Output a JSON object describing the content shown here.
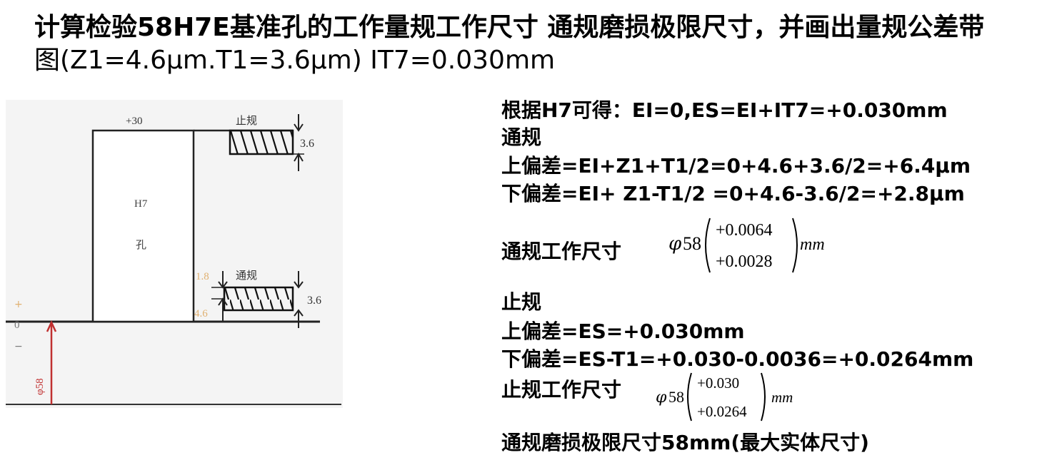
{
  "title": {
    "line1": "计算检验58H7E基准孔的工作量规工作尺寸 通规磨损极限尺寸，并画出量规公差带",
    "line2": "图(Z1=4.6μm.T1=3.6μm) IT7=0.030mm"
  },
  "figure": {
    "top_dev": "+30",
    "hole_label": "H7",
    "hole_char": "孔",
    "nogo_label": "止规",
    "go_label": "通规",
    "nogo_width": "3.6",
    "go_width": "3.6",
    "half_t": "1.8",
    "z1": "4.6",
    "plus_sign": "+",
    "zero": "0",
    "minus_sign": "−",
    "diameter": "φ58"
  },
  "calc": {
    "line1": "根据H7可得：EI=0,ES=EI+IT7=+0.030mm",
    "go_heading": "通规",
    "go_upper": "上偏差=EI+Z1+T1/2=0+4.6+3.6/2=+6.4μm",
    "go_lower": "下偏差=EI+ Z1-T1/2 =0+4.6-3.6/2=+2.8μm",
    "go_size_label": "通规工作尺寸",
    "go_formula": {
      "phi": "φ",
      "base": "58",
      "upper": "+0.0064",
      "lower": "+0.0028",
      "unit": "mm"
    },
    "nogo_heading": "止规",
    "nogo_upper": "上偏差=ES=+0.030mm",
    "nogo_lower": "下偏差=ES-T1=+0.030-0.0036=+0.0264mm",
    "nogo_size_label": "止规工作尺寸",
    "nogo_formula": {
      "phi": "φ",
      "base": "58",
      "upper": "+0.030",
      "lower": "+0.0264",
      "unit": "mm"
    },
    "wear_limit": "通规磨损极限尺寸58mm(最大实体尺寸)"
  }
}
